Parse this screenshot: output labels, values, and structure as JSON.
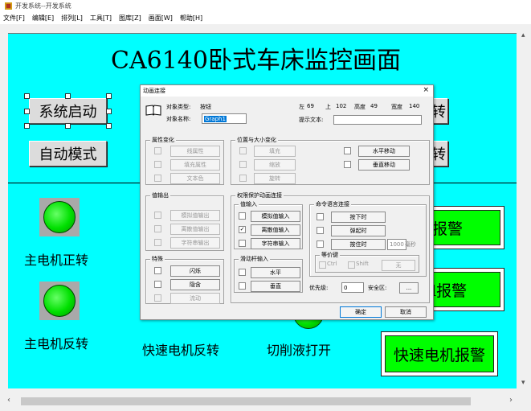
{
  "window": {
    "title": "开发系统--开发系统"
  },
  "menu": [
    "文件[F]",
    "编辑[E]",
    "排列[L]",
    "工具[T]",
    "图库[Z]",
    "画面[W]",
    "帮助[H]"
  ],
  "screen": {
    "title": "CA6140卧式车床监控画面",
    "buttons": {
      "start": "系统启动",
      "auto": "自动模式",
      "right1": "转",
      "right2": "转"
    },
    "lamps": {
      "forward": "主电机正转",
      "reverse": "主电机反转",
      "fast_reverse": "快速电机反转",
      "coolant": "切削液打开"
    },
    "alarms": {
      "alarm1": "报警",
      "alarm2": "l报警",
      "alarm3": "快速电机报警"
    },
    "colors": {
      "canvas": "#00ffff",
      "lamp_on": "#00e000",
      "alarm_bg": "#00ff00"
    }
  },
  "dialog": {
    "title": "动画连接",
    "close": "×",
    "object_type_label": "对象类型:",
    "object_type_value": "按钮",
    "object_name_label": "对象名称:",
    "object_name_value": "Graph1",
    "geom": {
      "left_label": "左",
      "left": "69",
      "top_label": "上",
      "top": "102",
      "height_label": "高度",
      "height": "49",
      "width_label": "宽度",
      "width": "140"
    },
    "hint_label": "提示文本:",
    "hint_value": "",
    "attr_group": {
      "label": "属性变化",
      "items": [
        "线属性",
        "填充属性",
        "文本色"
      ]
    },
    "pos_group": {
      "label": "位置与大小变化",
      "items": [
        "填充",
        "缩放",
        "旋转"
      ],
      "move_h": "水平移动",
      "move_v": "垂直移动"
    },
    "out_group": {
      "label": "值输出",
      "items": [
        "模拟值输出",
        "离散值输出",
        "字符串输出"
      ]
    },
    "perm_group": {
      "label": "权限保护动画连接"
    },
    "in_group": {
      "label": "值输入",
      "items": [
        "模拟值输入",
        "离散值输入",
        "字符串输入"
      ],
      "checked": [
        false,
        true,
        false
      ]
    },
    "slider_group": {
      "label": "滑动杆输入",
      "items": [
        "水平",
        "垂直"
      ]
    },
    "cmd_group": {
      "label": "命令语言连接",
      "items": [
        "按下时",
        "弹起时",
        "按住时"
      ],
      "hold_ms": "1000",
      "ms_unit": "毫秒"
    },
    "equiv_group": {
      "label": "等价键",
      "ctrl": "Ctrl",
      "shift": "Shift",
      "key": "无"
    },
    "special_group": {
      "label": "特殊",
      "items": [
        "闪烁",
        "隐含",
        "流动"
      ]
    },
    "priority_label": "优先级:",
    "priority_value": "0",
    "security_label": "安全区:",
    "security_btn": "...",
    "ok": "确定",
    "cancel": "取消"
  }
}
